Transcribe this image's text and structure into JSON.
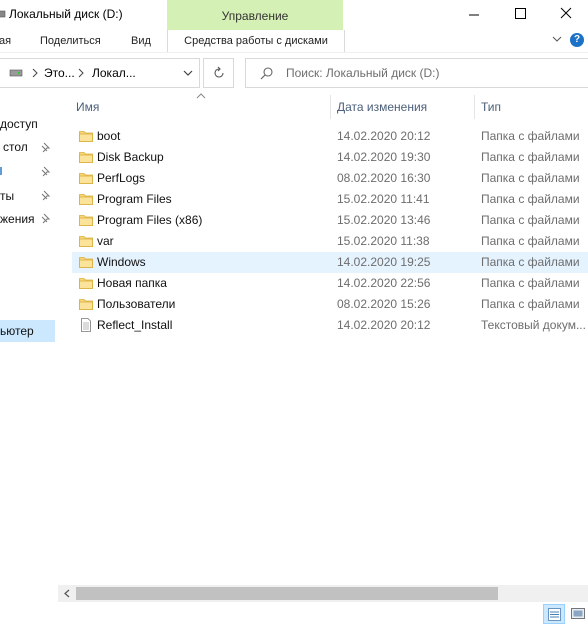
{
  "window": {
    "title": "Локальный диск (D:)",
    "manage_tab": "Управление"
  },
  "ribbon": {
    "tab_partial": "ая",
    "tab_share": "Поделиться",
    "tab_view": "Вид",
    "tab_disk_tools": "Средства работы с дисками"
  },
  "address": {
    "crumb1": "Это...",
    "crumb2": "Локал...",
    "search_placeholder": "Поиск: Локальный диск (D:)"
  },
  "nav": {
    "items": [
      {
        "label": "доступ",
        "pinned": false
      },
      {
        "label": "стол",
        "pinned": true
      },
      {
        "label": "",
        "pinned": true
      },
      {
        "label": "ты",
        "pinned": true
      },
      {
        "label": "жения",
        "pinned": true
      }
    ],
    "computer": "ьютер"
  },
  "columns": {
    "name": "Имя",
    "date": "Дата изменения",
    "type": "Тип"
  },
  "files": [
    {
      "name": "boot",
      "date": "14.02.2020 20:12",
      "type": "Папка с файлами",
      "kind": "folder"
    },
    {
      "name": "Disk Backup",
      "date": "14.02.2020 19:30",
      "type": "Папка с файлами",
      "kind": "folder"
    },
    {
      "name": "PerfLogs",
      "date": "08.02.2020 16:30",
      "type": "Папка с файлами",
      "kind": "folder"
    },
    {
      "name": "Program Files",
      "date": "15.02.2020 11:41",
      "type": "Папка с файлами",
      "kind": "folder"
    },
    {
      "name": "Program Files (x86)",
      "date": "15.02.2020 13:46",
      "type": "Папка с файлами",
      "kind": "folder"
    },
    {
      "name": "var",
      "date": "15.02.2020 11:38",
      "type": "Папка с файлами",
      "kind": "folder"
    },
    {
      "name": "Windows",
      "date": "14.02.2020 19:25",
      "type": "Папка с файлами",
      "kind": "folder",
      "selected": true
    },
    {
      "name": "Новая папка",
      "date": "14.02.2020 22:56",
      "type": "Папка с файлами",
      "kind": "folder"
    },
    {
      "name": "Пользователи",
      "date": "08.02.2020 15:26",
      "type": "Папка с файлами",
      "kind": "folder"
    },
    {
      "name": "Reflect_Install",
      "date": "14.02.2020 20:12",
      "type": "Текстовый докум...",
      "kind": "text"
    }
  ],
  "colors": {
    "manage_tab_bg": "#d5f0b4",
    "selection_bg": "#cce8ff",
    "hover_row_bg": "#e5f3ff",
    "folder_yellow": "#f8d775",
    "header_text": "#4c607a"
  }
}
